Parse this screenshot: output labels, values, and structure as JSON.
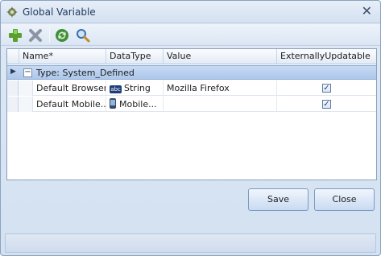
{
  "window": {
    "title": "Global Variable",
    "close_glyph": "✕"
  },
  "toolbar": {
    "buttons": [
      {
        "name": "add-icon"
      },
      {
        "name": "delete-icon"
      },
      {
        "name": "refresh-icon"
      },
      {
        "name": "search-icon"
      }
    ]
  },
  "grid": {
    "columns": [
      "Name*",
      "DataType",
      "Value",
      "ExternallyUpdatable"
    ],
    "group": {
      "toggle": "−",
      "label": "Type: System_Defined"
    },
    "rows": [
      {
        "name": "Default Browser",
        "datatype": "String",
        "datatype_icon": "string-type-icon",
        "value": "Mozilla Firefox",
        "externally_updatable": true
      },
      {
        "name": "Default Mobile...",
        "datatype": "Mobile...",
        "datatype_icon": "mobile-type-icon",
        "value": "",
        "externally_updatable": true
      }
    ],
    "abc_glyph": "abc",
    "check_glyph": "✓"
  },
  "buttons": {
    "save": "Save",
    "close": "Close"
  },
  "colors": {
    "accent": "#adc8ec",
    "title": "#1f3a5c",
    "border": "#8aa0bd"
  }
}
